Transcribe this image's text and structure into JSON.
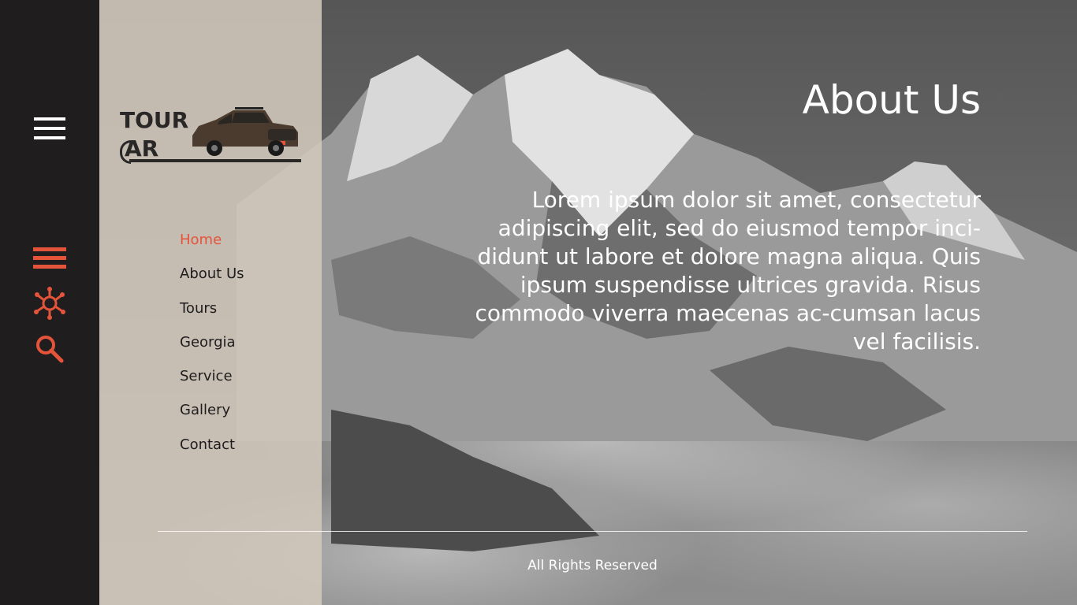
{
  "brand": {
    "logo_line1": "TOUR",
    "logo_line2": "AR"
  },
  "rail": {
    "icons": [
      "hamburger-menu-icon",
      "list-icon",
      "network-icon",
      "search-icon"
    ],
    "accent_color": "#e4543a"
  },
  "nav": {
    "items": [
      {
        "label": "Home",
        "active": true
      },
      {
        "label": "About Us",
        "active": false
      },
      {
        "label": "Tours",
        "active": false
      },
      {
        "label": "Georgia",
        "active": false
      },
      {
        "label": "Service",
        "active": false
      },
      {
        "label": "Gallery",
        "active": false
      },
      {
        "label": "Contact",
        "active": false
      }
    ],
    "active_color": "#e4543a"
  },
  "main": {
    "title": "About Us",
    "body": "Lorem ipsum dolor sit amet, consectetur adipiscing elit, sed do eiusmod tempor inci-didunt ut labore et dolore magna aliqua. Quis ipsum suspendisse ultrices gravida. Risus commodo viverra maecenas ac-cumsan lacus vel facilisis."
  },
  "footer": {
    "text": "All Rights Reserved"
  }
}
